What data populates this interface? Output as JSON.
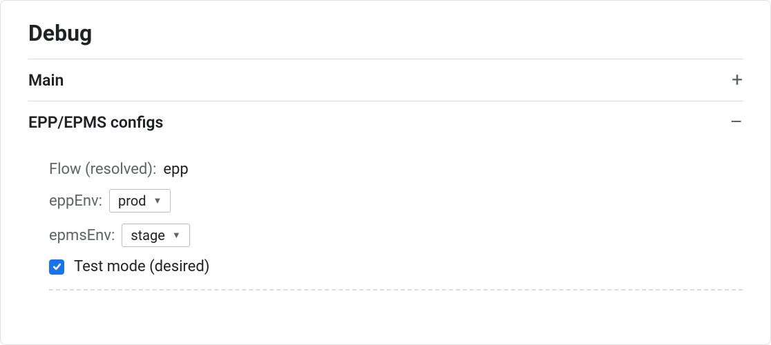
{
  "panel": {
    "title": "Debug"
  },
  "sections": {
    "main": {
      "title": "Main",
      "expand_icon": "+"
    },
    "configs": {
      "title": "EPP/EPMS configs",
      "expand_icon": "–"
    }
  },
  "configs": {
    "flow": {
      "label": "Flow (resolved):",
      "value": "epp"
    },
    "eppEnv": {
      "label": "eppEnv:",
      "selected": "prod"
    },
    "epmsEnv": {
      "label": "epmsEnv:",
      "selected": "stage"
    },
    "testMode": {
      "label": "Test mode (desired)",
      "checked": true
    }
  }
}
